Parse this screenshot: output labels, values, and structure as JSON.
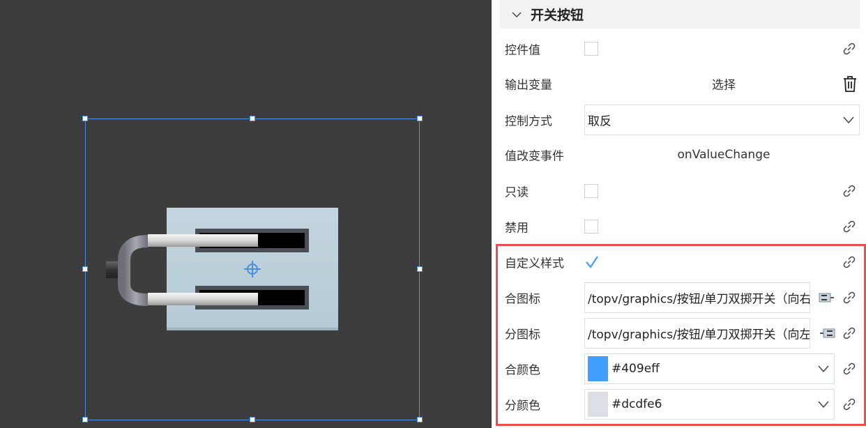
{
  "canvas": {
    "selection_color": "#4a90e2",
    "background": "#3d3d3d"
  },
  "panel": {
    "section_title": "开关按钮",
    "rows": {
      "control_value": {
        "label": "控件值",
        "checked": false
      },
      "output_var": {
        "label": "输出变量",
        "value": "选择"
      },
      "control_mode": {
        "label": "控制方式",
        "value": "取反"
      },
      "value_change_event": {
        "label": "值改变事件",
        "value": "onValueChange"
      },
      "readonly": {
        "label": "只读",
        "checked": false
      },
      "disabled": {
        "label": "禁用",
        "checked": false
      },
      "custom_style": {
        "label": "自定义样式",
        "checked": true
      },
      "close_icon": {
        "label": "合图标",
        "value": "/topv/graphics/按钮/单刀双掷开关（向右"
      },
      "open_icon": {
        "label": "分图标",
        "value": "/topv/graphics/按钮/单刀双掷开关（向左"
      },
      "close_color": {
        "label": "合颜色",
        "value": "#409eff",
        "swatch": "#409eff"
      },
      "open_color": {
        "label": "分颜色",
        "value": "#dcdfe6",
        "swatch": "#dcdfe6"
      }
    },
    "highlight_color": "#ef4d4d"
  }
}
